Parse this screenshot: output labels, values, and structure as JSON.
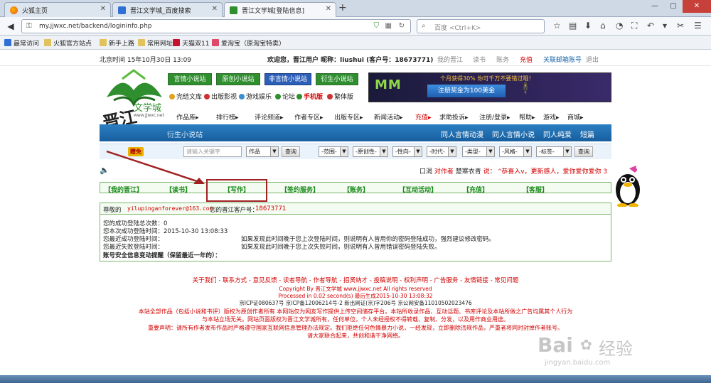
{
  "browser": {
    "tabs": [
      {
        "title": "火狐主页",
        "active": false
      },
      {
        "title": "晋江文学城_百度搜索",
        "active": false
      },
      {
        "title": "晋江文学城[登陆信息]",
        "active": true
      }
    ],
    "url": "my.jjwxc.net/backend/logininfo.php",
    "search_placeholder": "百度 <Ctrl+K>",
    "bookmarks": [
      "最常访问",
      "火狐官方站点",
      "新手上路",
      "常用网址",
      "天猫双11",
      "爱淘宝（原淘宝特卖）"
    ]
  },
  "colors": {
    "green": "#2f8f2f",
    "blue": "#1a64a8",
    "red": "#d20000",
    "accent_red": "#c8403a"
  },
  "site": {
    "topbar": {
      "time_label": "北京时间 15年10月30日 13:09",
      "welcome": "欢迎您，晋江用户  昵称：liushui  (客户号：18673771)",
      "links": [
        "我的晋江",
        "读书",
        "账务",
        "充值",
        "关联邮箱账号",
        "退出"
      ]
    },
    "logo_text": "文学城",
    "logo_url": "www.jjwxc.net",
    "logo_brand": "晋江",
    "green_buttons": [
      "言情小说站",
      "原创小说站",
      "非言情小说站",
      "衍生小说站"
    ],
    "small_links": [
      "完结文库",
      "出版影视",
      "游戏娱乐",
      "论坛",
      "手机版",
      "繁体版"
    ],
    "ad": {
      "top": "个月获得30%  你可千万不要错过哦！",
      "bottom": "注册奖金为100美金"
    },
    "menu": [
      "作品库",
      "排行榜",
      "评论频道",
      "作者专区",
      "出版专区",
      "新闻活动",
      "充值",
      "求助投诉",
      "注册/登录",
      "帮助",
      "游戏",
      "商城"
    ],
    "bluebar": {
      "left": "衍生小说站",
      "right": [
        "同人言情动漫",
        "同人言情小说",
        "同人纯爱",
        "短篇"
      ]
    },
    "search": {
      "badge": "赠免",
      "placeholder": "请输入关键字",
      "type": "作品",
      "button": "查询",
      "filters": [
        "-范围-",
        "-原创性-",
        "-性向-",
        "-时代-",
        "-类型-",
        "-风格-",
        "-标签-"
      ],
      "button2": "查询"
    },
    "marquee": {
      "tag": "口渴",
      "author": "对作者",
      "title": "楚寒衣青",
      "says": "说：",
      "text": "“恭喜入v，更新感人，爱你爱你爱你 3"
    },
    "usernav": [
      "【我的晋江】",
      "【读书】",
      "【写作】",
      "【签约服务】",
      "【账务】",
      "【互动活动】",
      "【充值】",
      "【客服】"
    ],
    "info": {
      "greeting": "尊敬的",
      "email": "yilupinganforever@163.com",
      "cust": "您的晋江客户号：",
      "cust_no": "18673771",
      "rows": [
        {
          "label": "您的成功登陆总次数：0",
          "note": ""
        },
        {
          "label": "您本次成功登陆时间：2015-10-30 13:08:33",
          "note": ""
        },
        {
          "label": "您最近成功登陆时间：",
          "note": "如果发现此时间晚于您上次登陆时间，则说明有人曾用你的密码登陆成功，强烈建议修改密码。"
        },
        {
          "label": "您最近失败登陆时间：",
          "note": "如果发现此时间晚于您上次失败时间，则说明有人曾用错误密码登陆失败。"
        }
      ],
      "warning": "账号安全信息变动提醒（保留最近一年的）："
    },
    "footer": {
      "links": "关于我们 - 联系方式 - 意见反馈 - 读者导航 - 作者导航 - 招贤纳才 - 投稿说明 - 权利声明 - 广告服务 - 友情链接 - 常见问题",
      "copyright": "Copyright By 晋江文学城 www.jjwxc.net All rights reserved",
      "processed": "Processed in 0.02 second(s) 最后生成2015-10-30 13:08:32",
      "icp": "京ICP证080637号 京ICP备12006214号-2 新出网证(京)字206号 京公网安备11010502023476",
      "notice1": "本站全部作品（包括小说和书评）版权为原创作者所有 本网站仅为网友写作提供上传空间储存平台。本站所收录作品、互动话题、书库评论及本站所做之广告均属其个人行为",
      "notice2": "与本站立场无关。网站页面版权为晋江文学城所有，任何单位，个人未经授权不得转载、复制、分发，以及用作商业用途。",
      "notice3": "重要声明：请所有作者发布作品时严格遵守国家互联网信息管理办法规定。我们拒绝任何色情暴力小说，一经发现，立即删除违规作品，严重者将同时封掉作者账号。",
      "notice4": "请大家联合起来，共创和谐干净网络。"
    },
    "watermark": {
      "brand": "Bai",
      "suffix": "经验",
      "url": "jingyan.baidu.com"
    }
  }
}
